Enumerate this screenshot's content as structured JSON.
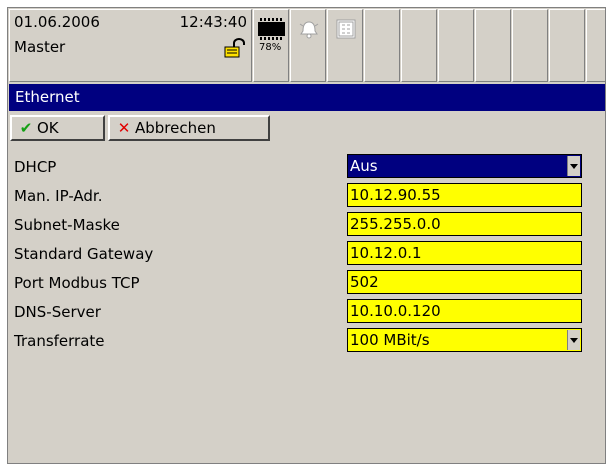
{
  "status": {
    "date": "01.06.2006",
    "time": "12:43:40",
    "mode": "Master",
    "memory_percent": "78%",
    "icons": [
      "lock-icon",
      "memory-chip-icon",
      "alarm-bell-icon",
      "schedule-icon"
    ]
  },
  "window": {
    "title": "Ethernet"
  },
  "toolbar": {
    "ok_label": "OK",
    "cancel_label": "Abbrechen"
  },
  "form": {
    "dhcp": {
      "label": "DHCP",
      "value": "Aus"
    },
    "ip": {
      "label": "Man. IP-Adr.",
      "value": "10.12.90.55"
    },
    "subnet": {
      "label": "Subnet-Maske",
      "value": "255.255.0.0"
    },
    "gateway": {
      "label": "Standard Gateway",
      "value": "10.12.0.1"
    },
    "port": {
      "label": "Port Modbus TCP",
      "value": "502"
    },
    "dns": {
      "label": "DNS-Server",
      "value": "10.10.0.120"
    },
    "rate": {
      "label": "Transferrate",
      "value": "100 MBit/s"
    }
  },
  "colors": {
    "title_bar": "#000080",
    "field_bg": "#ffff00",
    "panel_bg": "#d4d0c8",
    "ok_check": "#14a014",
    "cancel_x": "#e00000"
  }
}
